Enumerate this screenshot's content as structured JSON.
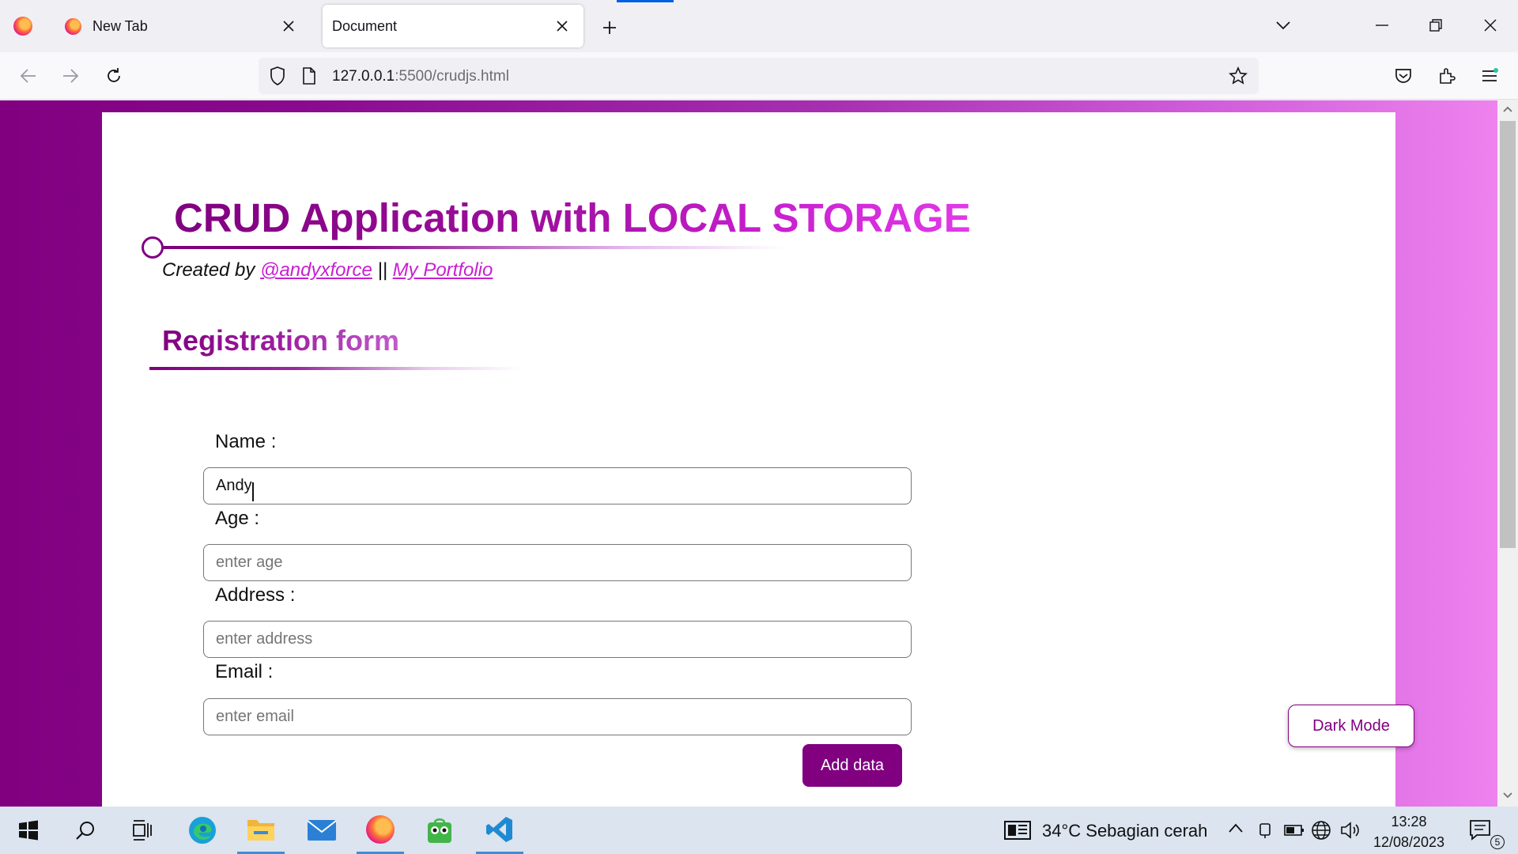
{
  "browser": {
    "tabs": [
      {
        "title": "New Tab",
        "active": false
      },
      {
        "title": "Document",
        "active": true
      }
    ],
    "url": {
      "host": "127.0.0.1",
      "rest": ":5500/crudjs.html"
    }
  },
  "page": {
    "title": "CRUD Application with LOCAL STORAGE",
    "created_by_prefix": "Created by",
    "author_link": "@andyxforce",
    "separator": "||",
    "portfolio_link": "My Portfolio",
    "form_title": "Registration form",
    "fields": [
      {
        "label": "Name :",
        "value": "Andy",
        "placeholder": ""
      },
      {
        "label": "Age :",
        "value": "",
        "placeholder": "enter age"
      },
      {
        "label": "Address :",
        "value": "",
        "placeholder": "enter address"
      },
      {
        "label": "Email :",
        "value": "",
        "placeholder": "enter email"
      }
    ],
    "add_button": "Add data",
    "dark_mode_button": "Dark Mode"
  },
  "taskbar": {
    "weather": "34°C  Sebagian cerah",
    "time": "13:28",
    "date": "12/08/2023",
    "notifications": "5"
  },
  "colors": {
    "accent": "#800080",
    "brand_light": "#ee82ee",
    "link": "#c81fd0"
  }
}
